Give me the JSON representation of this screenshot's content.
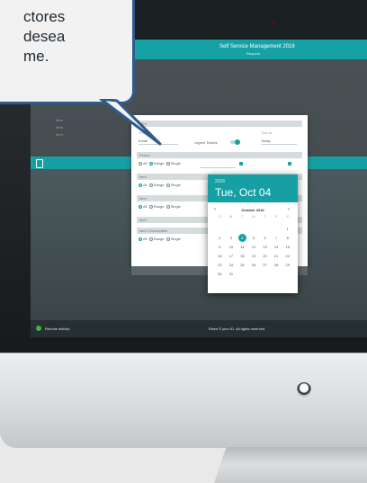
{
  "speech_bubble": {
    "lines": [
      "ctores",
      "desea",
      "me."
    ]
  },
  "app": {
    "title": "Self Service Management 2018",
    "subtitle": "Request"
  },
  "left_labels": [
    "Item",
    "Item",
    "Item"
  ],
  "form": {
    "section_1": "Item",
    "field_a_label": "Channel",
    "field_a_value": "Email",
    "toggle_label": "Urgent Tickets",
    "field_b_label": "Time for",
    "field_b_value": "Today",
    "section_2": "Period",
    "radio_all": "All",
    "radio_range": "Range",
    "radio_single": "Single",
    "section_3": "Item",
    "section_4": "Item",
    "section_5": "Item",
    "section_6": "Item / Description"
  },
  "date_picker": {
    "year": "2016",
    "date": "Tue, Oct 04",
    "month": "October 2016",
    "prev": "‹",
    "next": "›",
    "weekdays": [
      "S",
      "M",
      "T",
      "W",
      "T",
      "F",
      "S"
    ],
    "weeks": [
      [
        "",
        "",
        "",
        "",
        "",
        "",
        "1"
      ],
      [
        "2",
        "3",
        "4",
        "5",
        "6",
        "7",
        "8"
      ],
      [
        "9",
        "10",
        "11",
        "12",
        "13",
        "14",
        "15"
      ],
      [
        "16",
        "17",
        "18",
        "19",
        "20",
        "21",
        "22"
      ],
      [
        "23",
        "24",
        "25",
        "26",
        "27",
        "28",
        "29"
      ],
      [
        "30",
        "31",
        "",
        "",
        "",
        "",
        ""
      ]
    ],
    "selected_day": "4",
    "today_day": "11"
  },
  "taskbar": {
    "left_text": "Remote activity",
    "right_text": "Rises © your ID. All rights reserved"
  },
  "colors": {
    "accent": "#16a1a5",
    "bubble_border": "#2f5b8a"
  }
}
